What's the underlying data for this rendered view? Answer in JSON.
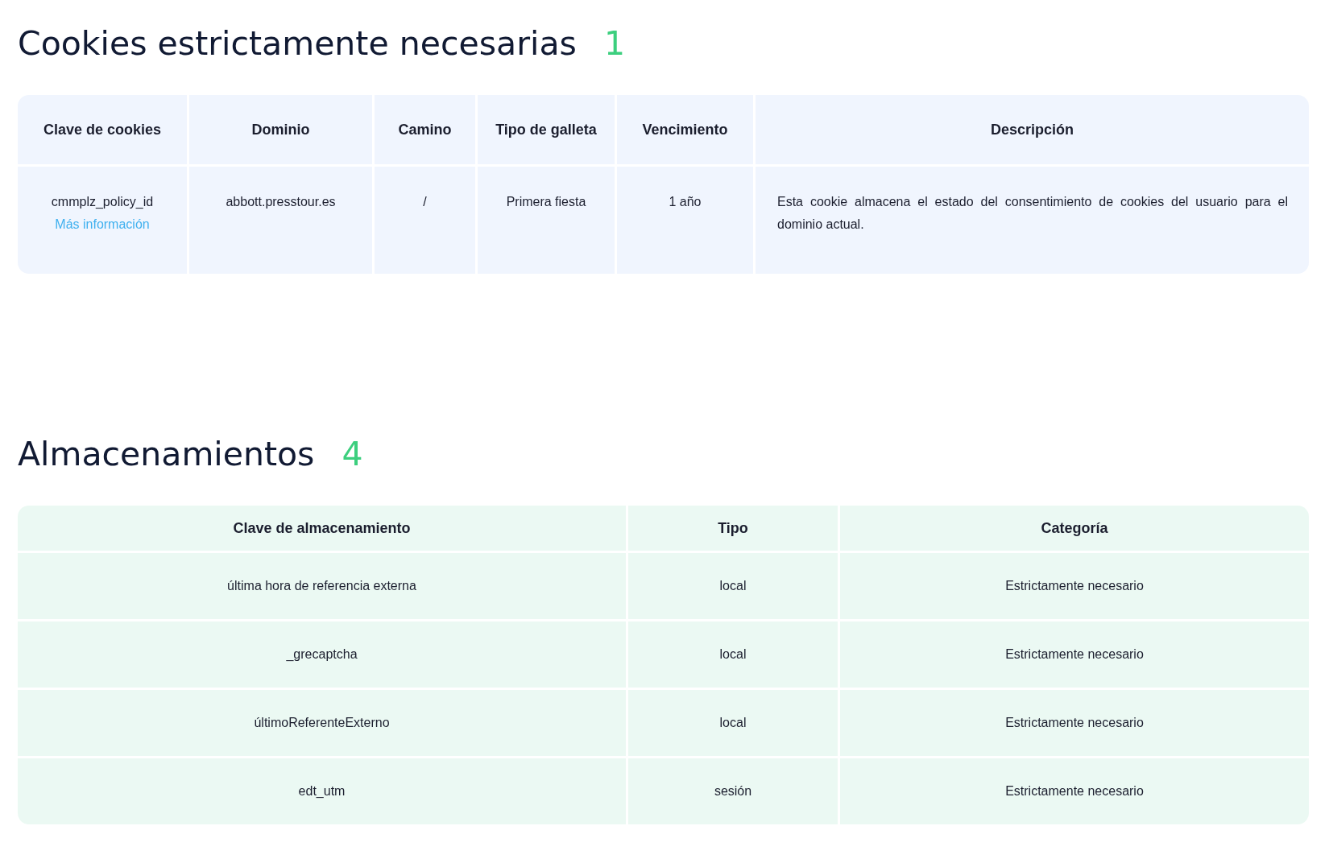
{
  "sections": [
    {
      "title": "Cookies estrictamente necesarias",
      "count": "1",
      "kind": "cookies",
      "columns": [
        "Clave de cookies",
        "Dominio",
        "Camino",
        "Tipo de galleta",
        "Vencimiento",
        "Descripción"
      ],
      "rows": [
        {
          "cells": [
            "cmmplz_policy_id",
            "abbott.presstour.es",
            "/",
            "Primera fiesta",
            "1 año",
            "Esta cookie almacena el estado del consentimiento de cookies del usuario para el dominio actual."
          ],
          "link": "Más información"
        }
      ]
    },
    {
      "title": "Almacenamientos",
      "count": "4",
      "kind": "storage",
      "columns": [
        "Clave de almacenamiento",
        "Tipo",
        "Categoría"
      ],
      "rows": [
        {
          "cells": [
            "última hora de referencia externa",
            "local",
            "Estrictamente necesario"
          ]
        },
        {
          "cells": [
            "_grecaptcha",
            "local",
            "Estrictamente necesario"
          ]
        },
        {
          "cells": [
            "últimoReferenteExterno",
            "local",
            "Estrictamente necesario"
          ]
        },
        {
          "cells": [
            "edt_utm",
            "sesión",
            "Estrictamente necesario"
          ]
        }
      ]
    }
  ]
}
